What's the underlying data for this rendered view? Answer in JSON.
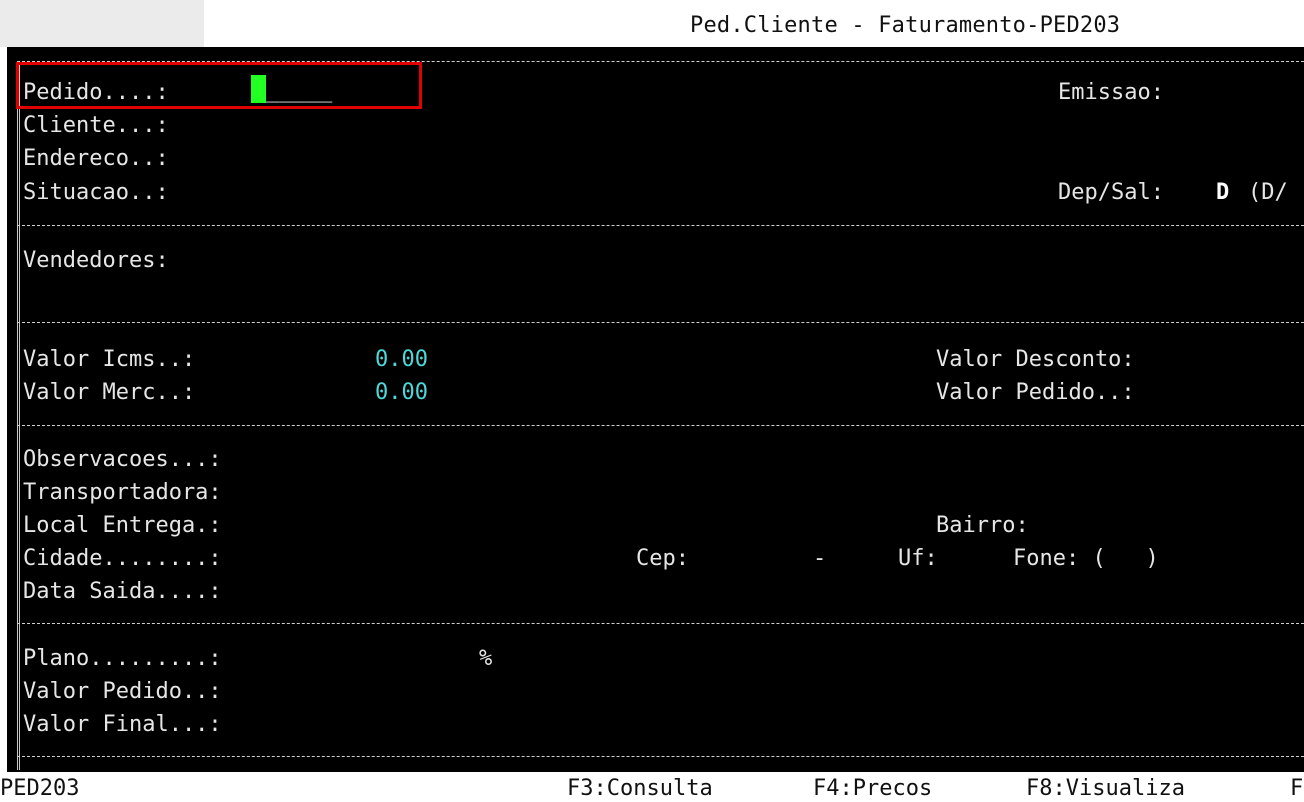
{
  "window": {
    "title": "Ped.Cliente - Faturamento-PED203"
  },
  "header": {
    "pedido_label": "Pedido....:",
    "pedido_value": "_____",
    "emissao_label": "Emissao:",
    "cliente_label": "Cliente...:",
    "endereco_label": "Endereco..:",
    "situacao_label": "Situacao..:",
    "depsal_label": "Dep/Sal:",
    "depsal_value": "D",
    "depsal_options": "(D/"
  },
  "vendedores": {
    "label": "Vendedores:"
  },
  "valores": {
    "icms_label": "Valor Icms..:",
    "icms_value": "0.00",
    "merc_label": "Valor Merc..:",
    "merc_value": "0.00",
    "desconto_label": "Valor Desconto:",
    "pedido_label": "Valor Pedido..:"
  },
  "entrega": {
    "observacoes_label": "Observacoes...:",
    "transportadora_label": "Transportadora:",
    "local_label": "Local Entrega.:",
    "bairro_label": "Bairro:",
    "cidade_label": "Cidade........:",
    "cep_label": "Cep:",
    "cep_sep": "-",
    "uf_label": "Uf:",
    "fone_label": "Fone: (   )",
    "data_saida_label": "Data Saida....:"
  },
  "pagamento": {
    "plano_label": "Plano.........:",
    "plano_percent": "%",
    "valor_pedido_label": "Valor Pedido..:",
    "valor_final_label": "Valor Final...:"
  },
  "statusbar": {
    "program": "PED203",
    "f3": "F3:Consulta",
    "f4": "F4:Precos",
    "f8": "F8:Visualiza",
    "more": "F"
  },
  "colors": {
    "background": "#000000",
    "text": "#e6e6e6",
    "value": "#4fd8d8",
    "cursor": "#22ff22",
    "highlight": "#e00000"
  }
}
